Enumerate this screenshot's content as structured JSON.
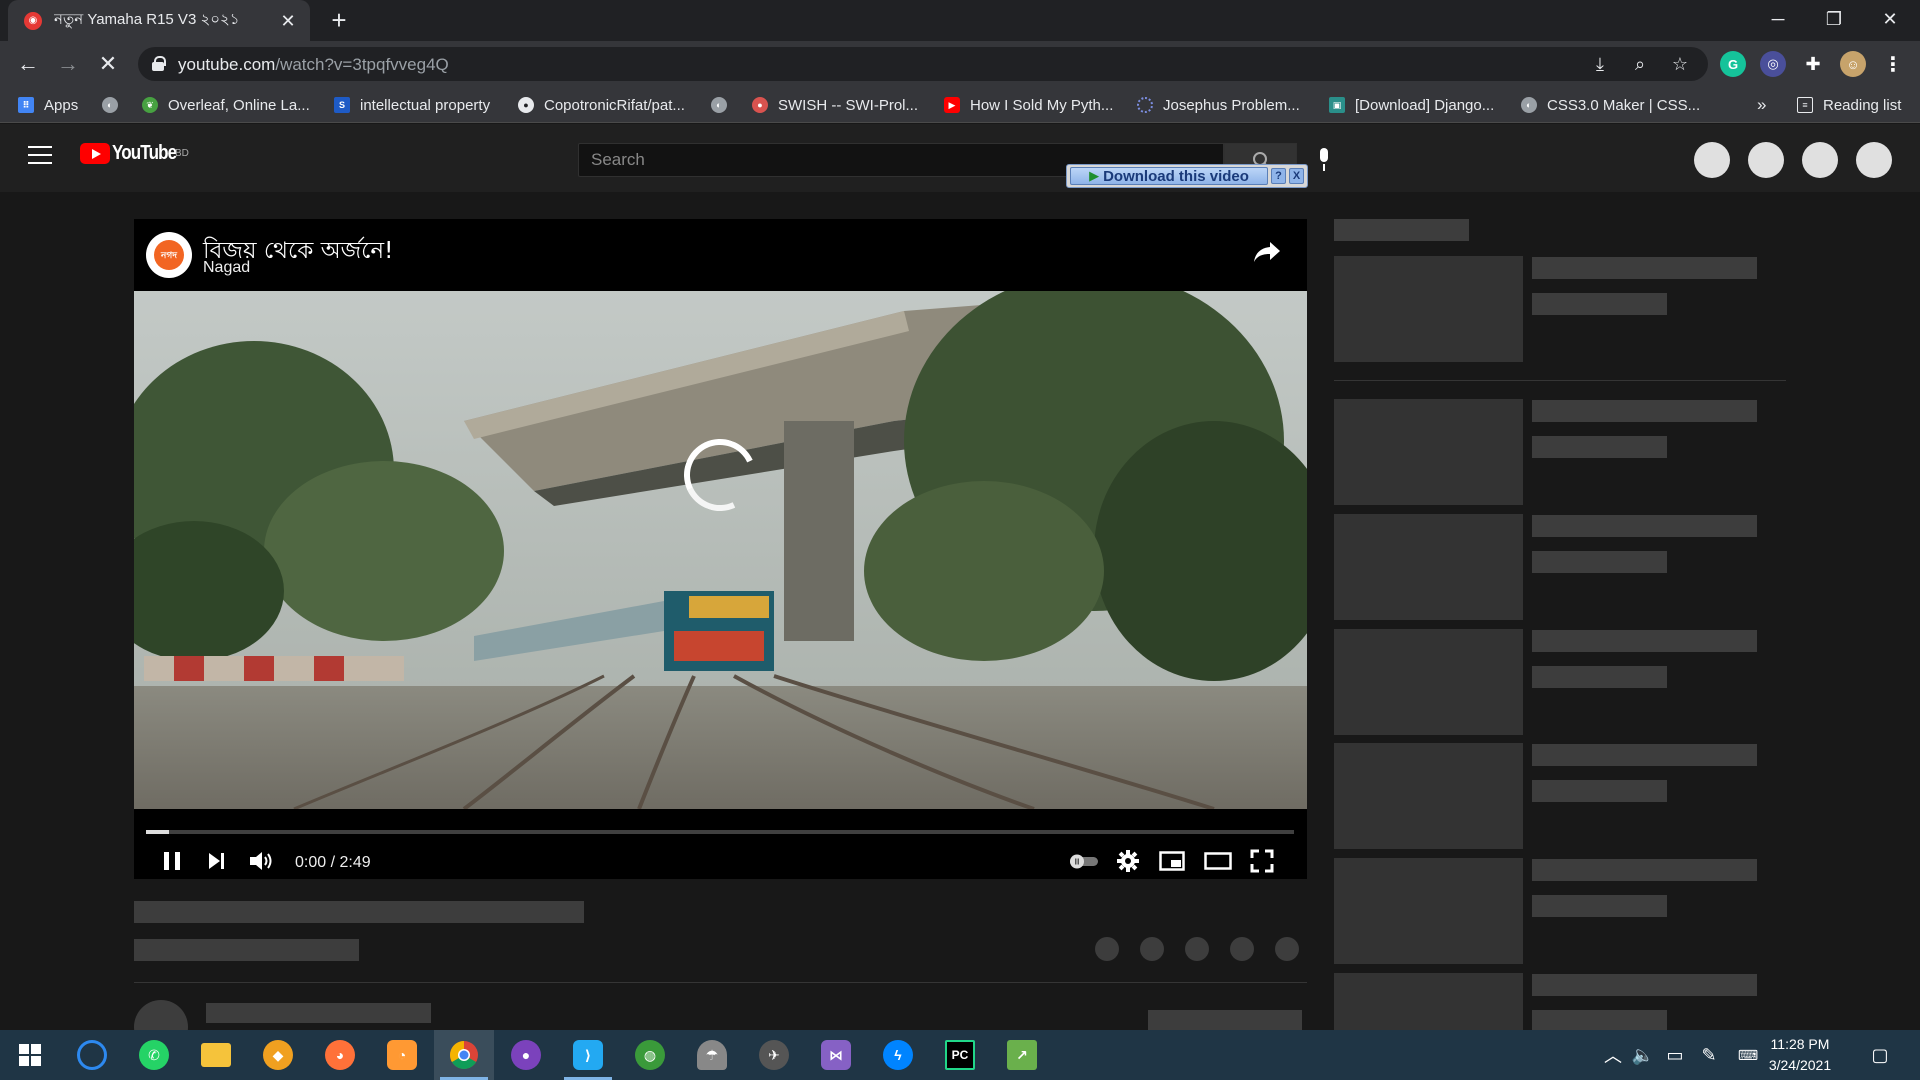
{
  "browser": {
    "tab_title": "নতুন Yamaha R15 V3 ২০২১",
    "url_host": "youtube.com",
    "url_path": "/watch?v=3tpqfvveg4Q",
    "bookmarks": [
      {
        "label": "Apps",
        "icon": "apps-grid-icon",
        "color": "#4285f4"
      },
      {
        "label": "",
        "icon": "globe-icon",
        "color": "#9aa0a6"
      },
      {
        "label": "Overleaf, Online La...",
        "icon": "overleaf-leaf-icon",
        "color": "#47a141"
      },
      {
        "label": "intellectual property",
        "icon": "s-icon",
        "color": "#1e5bc6"
      },
      {
        "label": "CopotronicRifat/pat...",
        "icon": "github-icon",
        "color": "#e8eaed"
      },
      {
        "label": "",
        "icon": "globe-icon",
        "color": "#9aa0a6"
      },
      {
        "label": "SWISH -- SWI-Prol...",
        "icon": "swish-icon",
        "color": "#d9534f"
      },
      {
        "label": "How I Sold My Pyth...",
        "icon": "youtube-icon",
        "color": "#ff0000"
      },
      {
        "label": "Josephus Problem...",
        "icon": "dotted-circle-icon",
        "color": "#7c8ee0"
      },
      {
        "label": "[Download] Django...",
        "icon": "django-icon",
        "color": "#2a8f8a"
      },
      {
        "label": "CSS3.0 Maker | CSS...",
        "icon": "globe-icon",
        "color": "#9aa0a6"
      }
    ],
    "bookmarks_overflow": "»",
    "reading_list": "Reading list"
  },
  "youtube": {
    "region": "BD",
    "search_placeholder": "Search",
    "download_label": "Download this video",
    "download_help": "?",
    "download_close": "X"
  },
  "video": {
    "title": "বিজয় থেকে অর্জনে!",
    "channel": "Nagad",
    "channel_avatar_text": "নগদ",
    "current_time": "0:00",
    "duration": "2:49",
    "time_display": "0:00 / 2:49",
    "progress_fraction": 0.02
  },
  "taskbar": {
    "apps": [
      {
        "name": "start",
        "icon": "windows-start-icon",
        "color": "#ffffff"
      },
      {
        "name": "app-refresh",
        "icon": "refresh-circle-icon",
        "color": "#2d89ef"
      },
      {
        "name": "whatsapp",
        "icon": "whatsapp-icon",
        "color": "#25d366"
      },
      {
        "name": "file-explorer",
        "icon": "folder-icon",
        "color": "#f5c33b"
      },
      {
        "name": "app-shield",
        "icon": "shield-badge-icon",
        "color": "#f0a020"
      },
      {
        "name": "firefox",
        "icon": "firefox-icon",
        "color": "#ff7139"
      },
      {
        "name": "app-orange",
        "icon": "orange-app-icon",
        "color": "#ff9933"
      },
      {
        "name": "chrome",
        "icon": "chrome-icon",
        "color": "#4285f4"
      },
      {
        "name": "github-desktop",
        "icon": "github-desktop-icon",
        "color": "#7b42bc"
      },
      {
        "name": "vscode",
        "icon": "vscode-icon",
        "color": "#23a9f2"
      },
      {
        "name": "app-globe",
        "icon": "globe-app-icon",
        "color": "#3a9a3a"
      },
      {
        "name": "app-umbrella",
        "icon": "umbrella-icon",
        "color": "#cccccc"
      },
      {
        "name": "app-satellite",
        "icon": "satellite-icon",
        "color": "#dddddd"
      },
      {
        "name": "visual-studio",
        "icon": "visual-studio-icon",
        "color": "#8661c5"
      },
      {
        "name": "messenger",
        "icon": "messenger-icon",
        "color": "#0084ff"
      },
      {
        "name": "pycharm",
        "icon": "pycharm-icon",
        "color": "#21d789"
      },
      {
        "name": "app-chart",
        "icon": "chart-app-icon",
        "color": "#6ab04c"
      }
    ],
    "clock_time": "11:28 PM",
    "clock_date": "3/24/2021"
  }
}
